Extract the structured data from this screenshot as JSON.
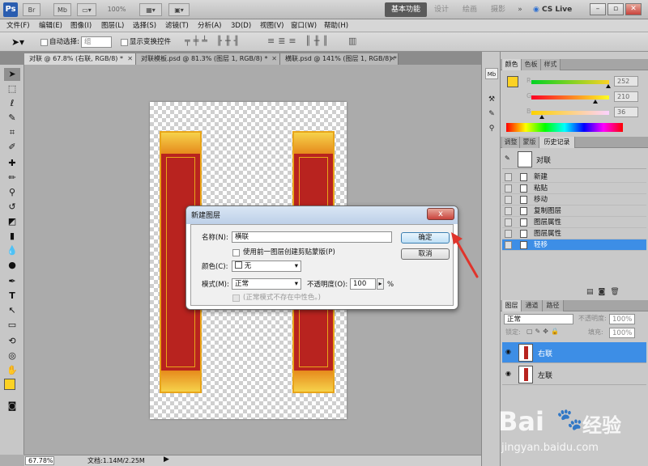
{
  "app": {
    "logo_text": "Ps",
    "title_buttons": [
      "Br",
      "Mb"
    ],
    "zoom_select": "100%",
    "workspaces": {
      "basic": "基本功能",
      "design": "设计",
      "paint": "绘画",
      "photo": "摄影",
      "more": "»"
    },
    "cs_live": "CS Live"
  },
  "menu": [
    "文件(F)",
    "编辑(E)",
    "图像(I)",
    "图层(L)",
    "选择(S)",
    "滤镜(T)",
    "分析(A)",
    "3D(D)",
    "视图(V)",
    "窗口(W)",
    "帮助(H)"
  ],
  "options": {
    "auto_select_label": "自动选择:",
    "auto_select_value": "组",
    "show_transform_label": "显示变换控件"
  },
  "tabs": [
    {
      "label": "对联 @ 67.8% (右联, RGB/8) *"
    },
    {
      "label": "对联模板.psd @ 81.3% (图层 1, RGB/8) *"
    },
    {
      "label": "横联.psd @ 141% (图层 1, RGB/8) *"
    }
  ],
  "status": {
    "zoom": "67.78%",
    "doc": "文档:1.14M/2.25M"
  },
  "color_panel": {
    "tabs": [
      "颜色",
      "色板",
      "样式"
    ],
    "r_label": "R",
    "g_label": "G",
    "b_label": "B",
    "r": "252",
    "g": "210",
    "b": "36",
    "r_level": 0.99,
    "g_level": 0.82,
    "b_level": 0.14,
    "foreground": "#fcd224"
  },
  "history_panel": {
    "tabs": [
      "调整",
      "蒙版",
      "历史记录"
    ],
    "snapshot": "对联",
    "items": [
      "新建",
      "粘贴",
      "移动",
      "复制图层",
      "图层属性",
      "图层属性",
      "轻移"
    ]
  },
  "layers_panel": {
    "tabs": [
      "图层",
      "通道",
      "路径"
    ],
    "blend": "正常",
    "opacity_label": "不透明度:",
    "opacity": "100%",
    "lock_label": "锁定:",
    "fill_label": "填充:",
    "fill": "100%",
    "layers": [
      "右联",
      "左联"
    ]
  },
  "dialog": {
    "title": "新建图层",
    "close": "x",
    "name_label": "名称(N):",
    "name_value": "横联",
    "clip_label": "使用前一图层创建剪贴蒙版(P)",
    "color_label": "颜色(C):",
    "color_value": "无",
    "mode_label": "模式(M):",
    "mode_value": "正常",
    "opacity_label": "不透明度(O):",
    "opacity_value": "100",
    "opacity_unit": "%",
    "neutral_label": "(正常模式不存在中性色。)",
    "ok": "确定",
    "cancel": "取消"
  },
  "watermark": {
    "brand": "Bai",
    "brand2": "经验",
    "url": "jingyan.baidu.com"
  }
}
